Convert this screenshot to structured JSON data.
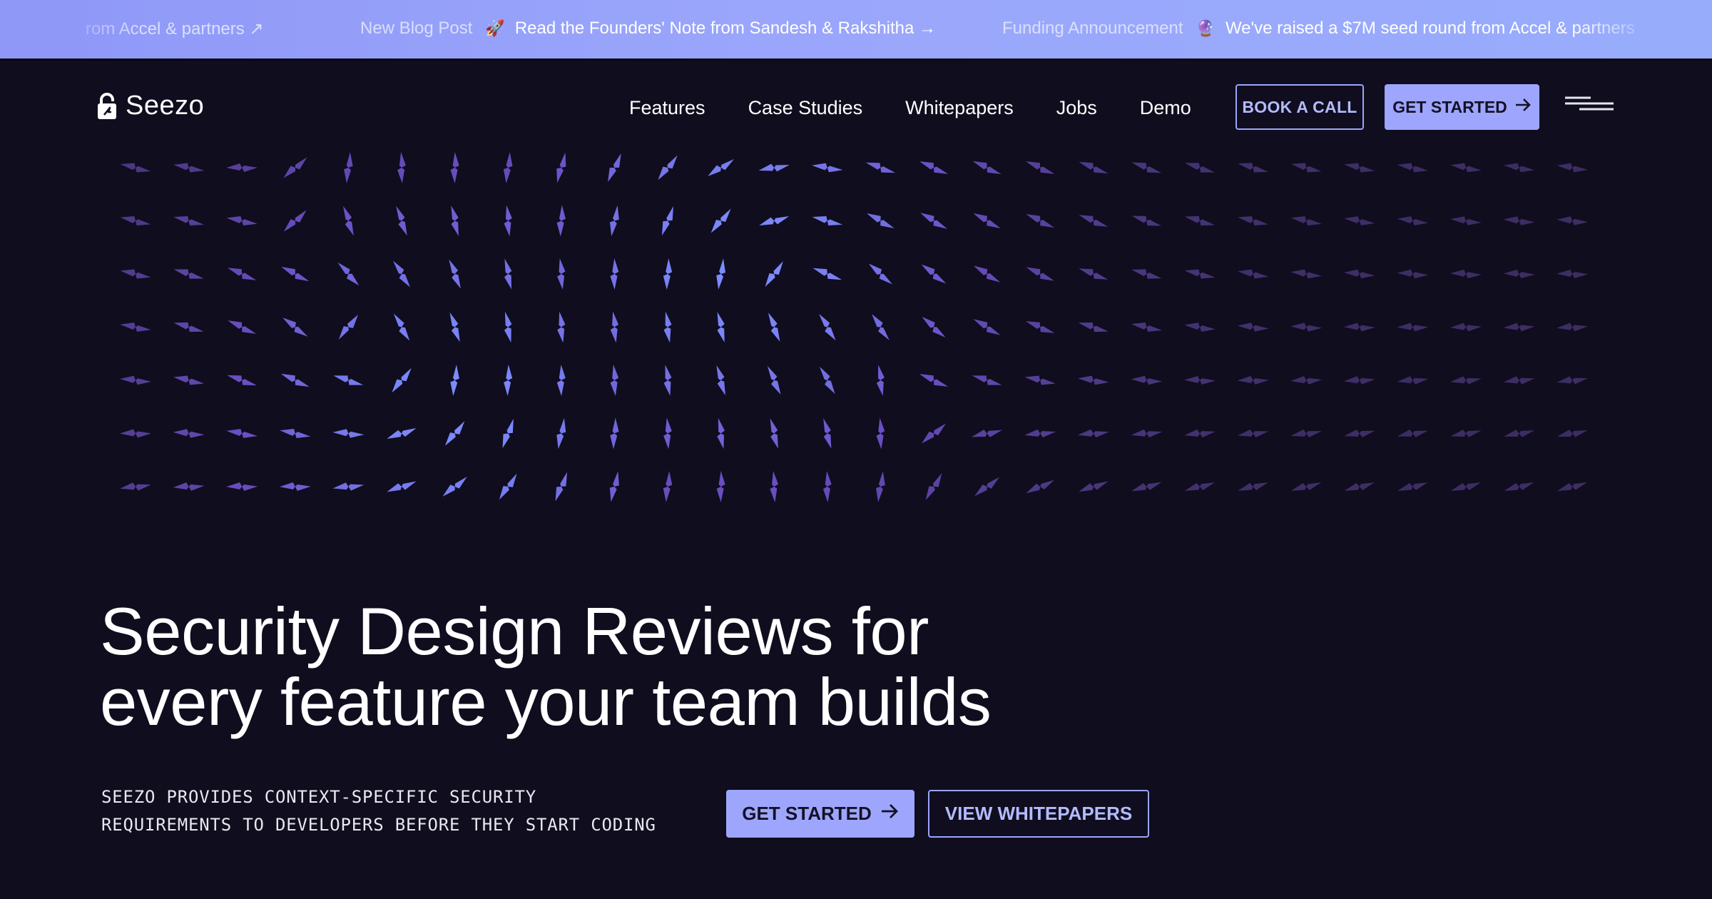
{
  "announcement": {
    "items": [
      {
        "kicker": "",
        "emoji": "",
        "message": "rom Accel & partners ↗"
      },
      {
        "kicker": "New Blog Post",
        "emoji": "🚀",
        "message": "Read the Founders' Note from Sandesh & Rakshitha →"
      },
      {
        "kicker": "Funding Announcement",
        "emoji": "🔮",
        "message": "We've raised a $7M seed round from Accel & partners"
      }
    ]
  },
  "nav": {
    "brand": "Seezo",
    "links": [
      "Features",
      "Case Studies",
      "Whitepapers",
      "Jobs",
      "Demo"
    ],
    "book_call": "BOOK A CALL",
    "get_started": "GET STARTED"
  },
  "hero": {
    "title_line1": "Security Design Reviews for",
    "title_line2": "every feature your team builds",
    "subtitle_line1": "SEEZO PROVIDES CONTEXT-SPECIFIC SECURITY",
    "subtitle_line2": "REQUIREMENTS TO DEVELOPERS BEFORE THEY START CODING",
    "primary_cta": "GET STARTED",
    "secondary_cta": "VIEW WHITEPAPERS"
  },
  "colors": {
    "background": "#100d1e",
    "accent": "#9da6fc",
    "arrow_dim": "#3c2d63",
    "arrow_mid": "#6a4fc4",
    "arrow_bright": "#7c8cff"
  },
  "icons": {
    "logo": "padlock-icon",
    "arrow": "arrow-right-icon",
    "menu": "hamburger-menu-icon"
  }
}
